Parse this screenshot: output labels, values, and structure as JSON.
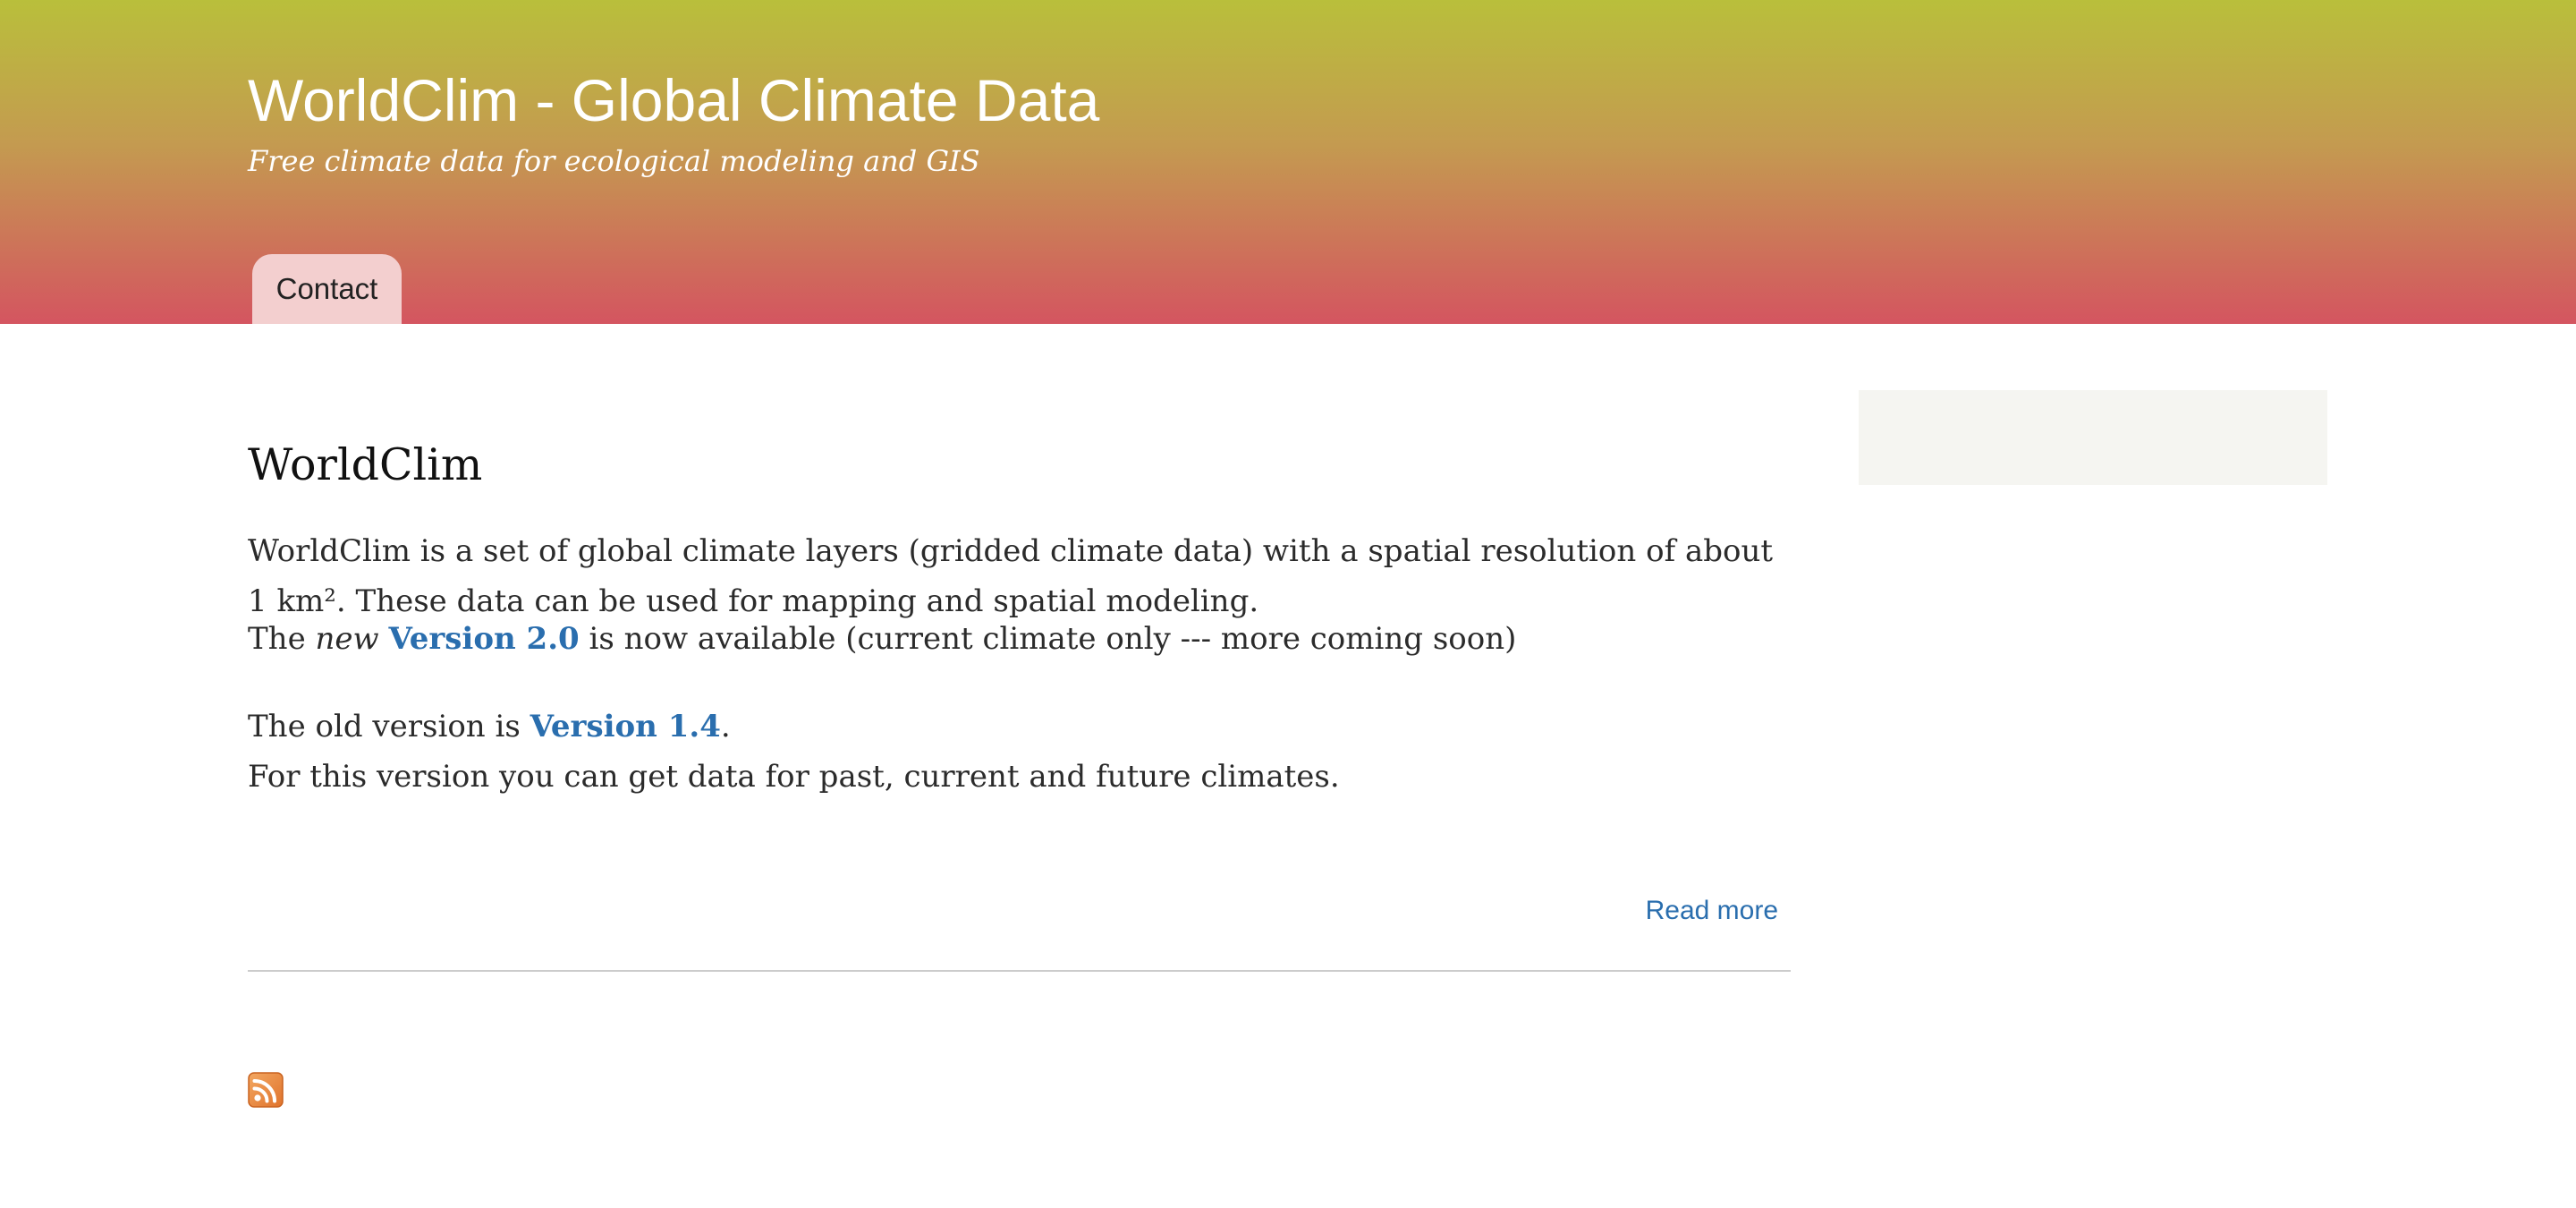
{
  "header": {
    "site_name": "WorldClim - Global Climate Data",
    "slogan": "Free climate data for ecological modeling and GIS",
    "gradient_colors": [
      "#b9bf3b",
      "#c49a50",
      "#d45560"
    ]
  },
  "nav": {
    "items": [
      {
        "label": "Contact"
      }
    ]
  },
  "content": {
    "title": "WorldClim",
    "intro": "WorldClim is a set of global climate layers (gridded climate data) with a spatial resolution of about 1 km². These data can be used for mapping and spatial modeling.",
    "version2": {
      "prefix": "The ",
      "emphasis": "new",
      "link_label": "Version 2.0",
      "suffix": " is now available (current climate only --- more coming soon)"
    },
    "version14": {
      "prefix": "The old version is ",
      "link_label": "Version 1.4",
      "suffix": ".",
      "note": "For this version you can get data for past, current and future climates."
    },
    "read_more": "Read more"
  },
  "footer": {
    "feed_icon": "rss-feed-icon"
  },
  "colors": {
    "link": "#2a6eae",
    "tab_bg": "#f3cfcf",
    "sidebar_bg": "#f5f5f1"
  }
}
